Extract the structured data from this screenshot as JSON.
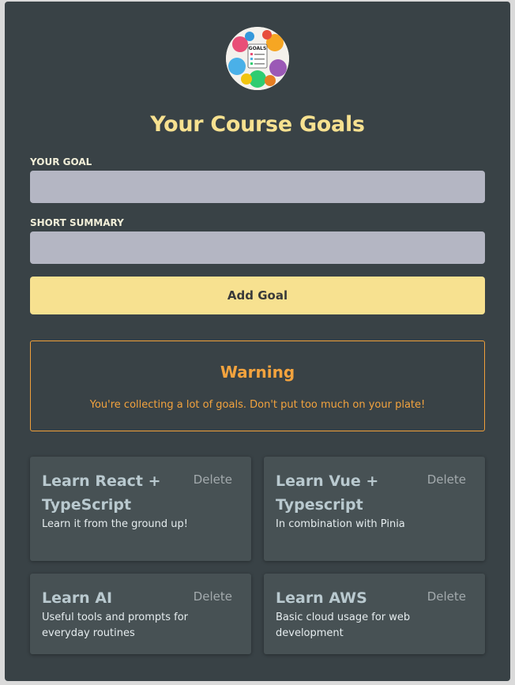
{
  "header": {
    "logo_label": "GOALS",
    "title": "Your Course Goals"
  },
  "form": {
    "goal_label": "YOUR GOAL",
    "goal_value": "",
    "summary_label": "SHORT SUMMARY",
    "summary_value": "",
    "add_button_label": "Add Goal"
  },
  "warning": {
    "title": "Warning",
    "message": "You're collecting a lot of goals. Don't put too much on your plate!"
  },
  "goals": [
    {
      "title": "Learn React + TypeScript",
      "summary": "Learn it from the ground up!",
      "delete_label": "Delete"
    },
    {
      "title": "Learn Vue + Typescript",
      "summary": "In combination with Pinia",
      "delete_label": "Delete"
    },
    {
      "title": "Learn AI",
      "summary": "Useful tools and prompts for everyday routines",
      "delete_label": "Delete"
    },
    {
      "title": "Learn AWS",
      "summary": "Basic cloud usage for web development",
      "delete_label": "Delete"
    }
  ],
  "colors": {
    "panel_bg": "#394246",
    "accent_yellow": "#f7e190",
    "input_bg": "#b4b6c3",
    "warning_orange": "#f3a33e",
    "card_bg": "#475154"
  }
}
